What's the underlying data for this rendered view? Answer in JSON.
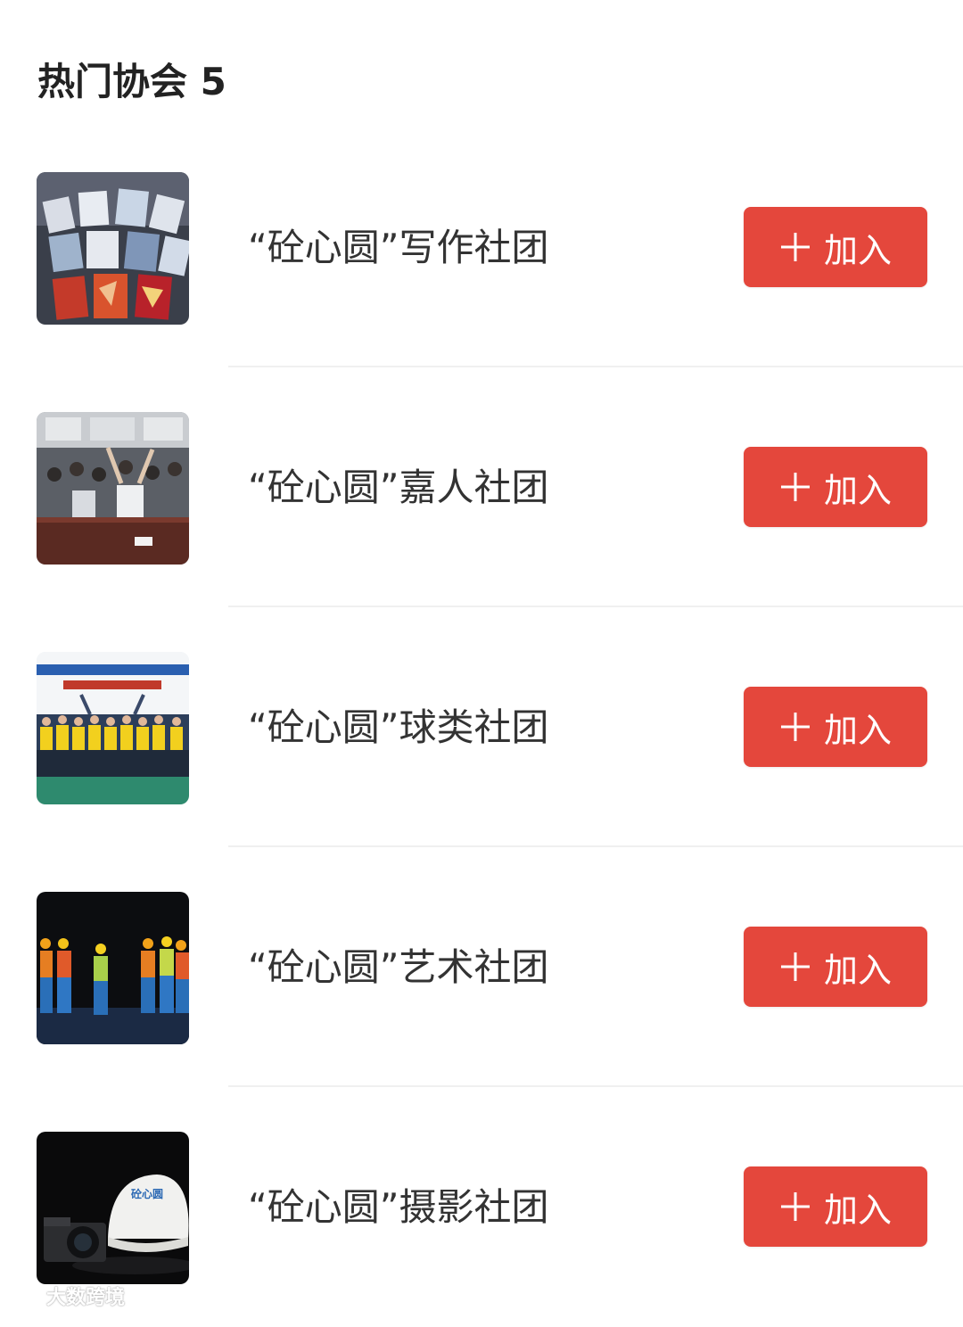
{
  "section": {
    "title": "热门协会 5"
  },
  "theme": {
    "button_color": "#e4473c"
  },
  "associations": [
    {
      "name": "“砼心圆”写作社团",
      "button_label": "加入",
      "thumbnail": "books-photo"
    },
    {
      "name": "“砼心圆”嘉人社团",
      "button_label": "加入",
      "thumbnail": "meeting-room-photo"
    },
    {
      "name": "“砼心圆”球类社团",
      "button_label": "加入",
      "thumbnail": "team-photo"
    },
    {
      "name": "“砼心圆”艺术社团",
      "button_label": "加入",
      "thumbnail": "stage-performance-photo"
    },
    {
      "name": "“砼心圆”摄影社团",
      "button_label": "加入",
      "thumbnail": "camera-cap-photo"
    }
  ],
  "watermark": {
    "text": "大数跨境",
    "logo_text": "砼心圆"
  }
}
